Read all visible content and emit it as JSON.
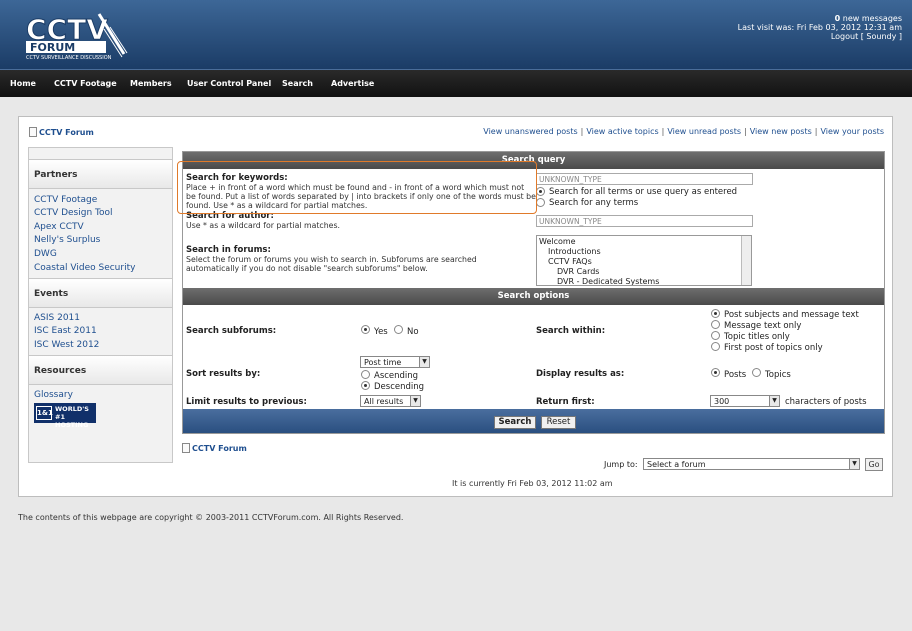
{
  "header": {
    "logo_text": "CCTV FORUM",
    "logo_tagline": "CCTV SURVEILLANCE DISCUSSION",
    "new_messages_count": "0",
    "new_messages_label": "new messages",
    "last_visit": "Last visit was: Fri Feb 03, 2012 12:31 am",
    "logout_label": "Logout [ Soundy ]"
  },
  "nav": {
    "items": [
      "Home",
      "CCTV Footage",
      "Members",
      "User Control Panel",
      "Search",
      "Advertise"
    ]
  },
  "breadcrumb": "CCTV Forum",
  "top_links": [
    "View unanswered posts",
    "View active topics",
    "View unread posts",
    "View new posts",
    "View your posts"
  ],
  "sidebar": {
    "partners_heading": "Partners",
    "partners": [
      "CCTV Footage",
      "CCTV Design Tool",
      "Apex CCTV",
      "Nelly's Surplus",
      "DWG",
      "Coastal Video Security"
    ],
    "events_heading": "Events",
    "events": [
      "ASIS 2011",
      "ISC East 2011",
      "ISC West 2012"
    ],
    "resources_heading": "Resources",
    "resources": [
      "Glossary"
    ],
    "hosting_badge_box": "1&1",
    "hosting_badge_line1": "WORLD'S #1",
    "hosting_badge_line2": "HOSTING"
  },
  "search_query": {
    "heading": "Search query",
    "keywords_label": "Search for keywords:",
    "keywords_hint": "Place + in front of a word which must be found and - in front of a word which must not be found. Put a list of words separated by | into brackets if only one of the words must be found. Use * as a wildcard for partial matches.",
    "keywords_value": "UNKNOWN_TYPE",
    "terms_all": "Search for all terms or use query as entered",
    "terms_any": "Search for any terms",
    "author_label": "Search for author:",
    "author_hint": "Use * as a wildcard for partial matches.",
    "author_value": "UNKNOWN_TYPE",
    "forums_label": "Search in forums:",
    "forums_hint": "Select the forum or forums you wish to search in. Subforums are searched automatically if you do not disable \"search subforums\" below.",
    "forums_list": [
      "Welcome",
      "Introductions",
      "CCTV FAQs",
      "DVR Cards",
      "DVR - Dedicated Systems"
    ]
  },
  "search_options": {
    "heading": "Search options",
    "subforums_label": "Search subforums:",
    "yes": "Yes",
    "no": "No",
    "within_label": "Search within:",
    "within_options": [
      "Post subjects and message text",
      "Message text only",
      "Topic titles only",
      "First post of topics only"
    ],
    "sort_label": "Sort results by:",
    "sort_value": "Post time",
    "ascending": "Ascending",
    "descending": "Descending",
    "display_label": "Display results as:",
    "posts": "Posts",
    "topics": "Topics",
    "limit_label": "Limit results to previous:",
    "limit_value": "All results",
    "return_label": "Return first:",
    "return_value": "300",
    "return_suffix": "characters of posts",
    "search_button": "Search",
    "reset_button": "Reset"
  },
  "bottom": {
    "breadcrumb": "CCTV Forum",
    "jump_label": "Jump to:",
    "jump_value": "Select a forum",
    "go_button": "Go",
    "current_time": "It is currently Fri Feb 03, 2012 11:02 am"
  },
  "footer": "The contents of this webpage are copyright © 2003-2011 CCTVForum.com. All Rights Reserved."
}
